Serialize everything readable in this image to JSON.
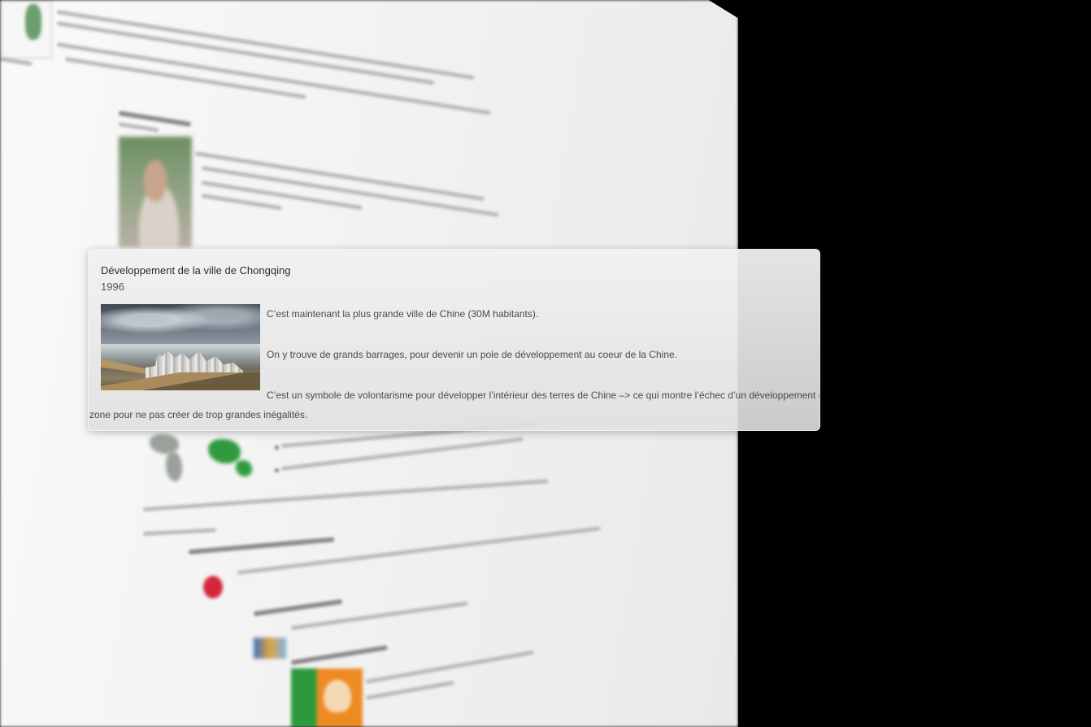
{
  "tooltip": {
    "title": "Développement de la ville de Chongqing",
    "year": "1996",
    "paragraphs": [
      "C’est maintenant la plus grande ville de Chine (30M habitants).",
      "On y trouve de grands barrages, pour devenir un pole de développement au coeur de la Chine.",
      "C’est un symbole de volontarisme pour développer l’intérieur des terres de Chine –> ce qui montre l’échec d’un développement uniforme sur toute la",
      "zone pour ne pas créer de trop grandes inégalités."
    ],
    "image_alt": "Chongqing"
  },
  "colors": {
    "tooltip_bg": "#dedede",
    "text": "#4a4a4a",
    "background": "#000000"
  }
}
